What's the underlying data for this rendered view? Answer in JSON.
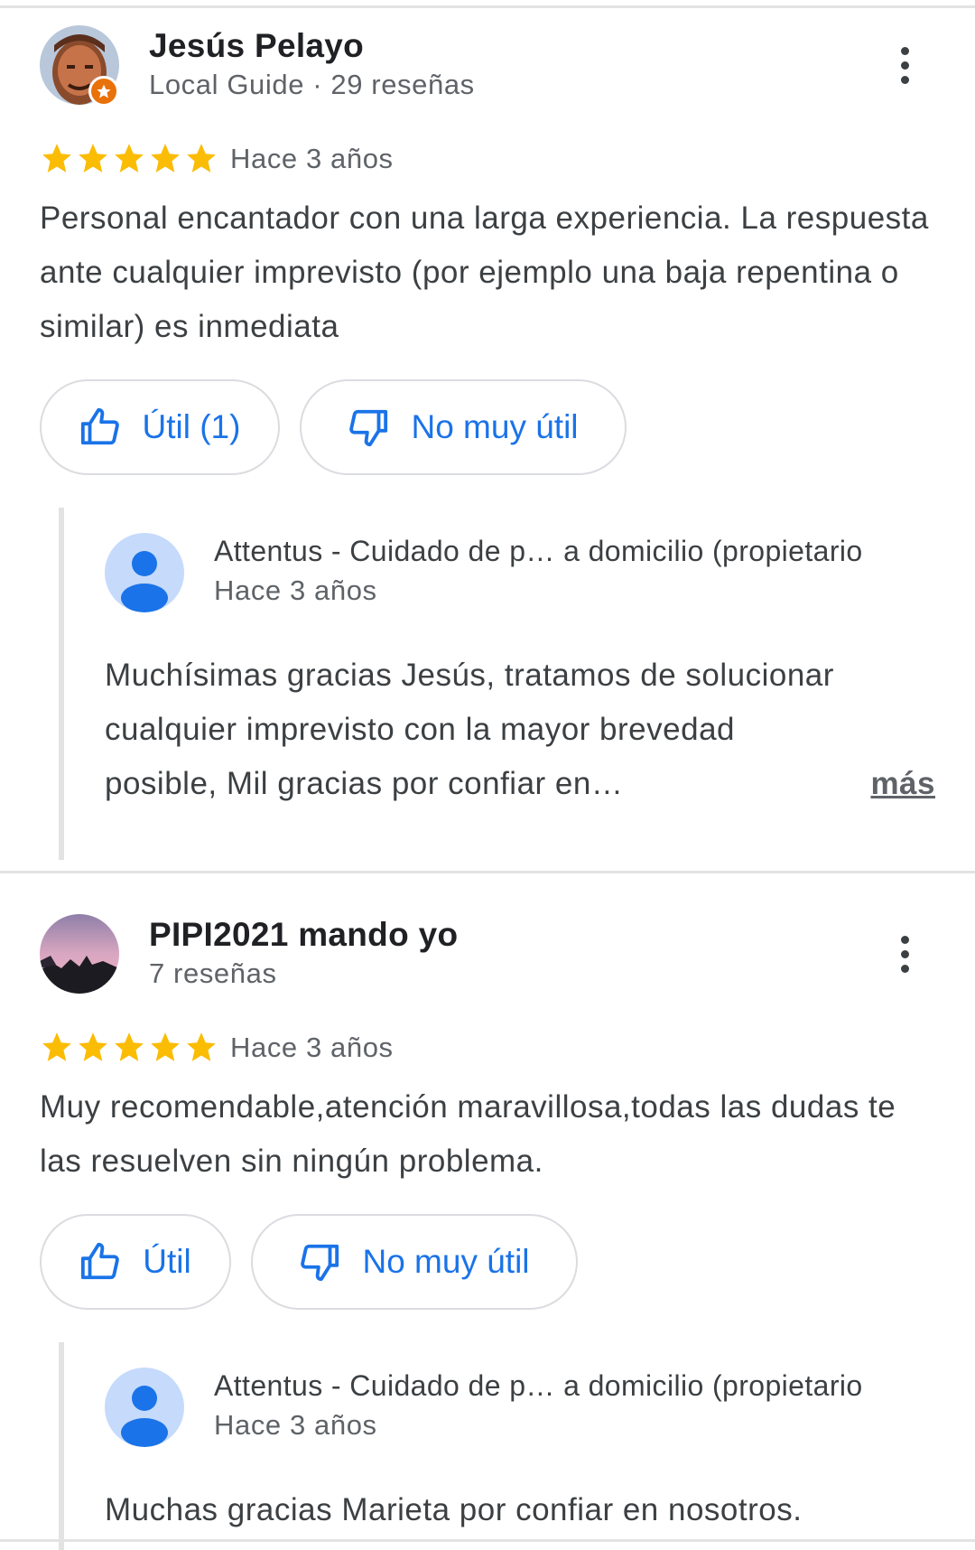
{
  "colors": {
    "star": "#fbbc04",
    "accent": "#1a73e8",
    "guide_badge": "#e8710a",
    "owner_avatar_bg": "#c6dafc",
    "owner_avatar_fg": "#1a73e8"
  },
  "icons": {
    "helpful": "thumb-up-icon",
    "not_helpful": "thumb-down-icon",
    "menu": "more-vert-icon",
    "rating": "star-icon",
    "guide": "local-guide-star-icon",
    "owner": "person-icon"
  },
  "reviews": [
    {
      "author": "Jesús Pelayo",
      "meta": "Local Guide · 29 reseñas",
      "rating": 5,
      "date": "Hace 3 años",
      "text": "Personal encantador con una larga experiencia. La respuesta ante cualquier imprevisto (por ejemplo una baja repentina o similar) es inmediata",
      "helpful_label": "Útil (1)",
      "not_helpful_label": "No muy útil",
      "reply": {
        "owner_name": "Attentus - Cuidado de p…  a domicilio (propietario",
        "date": "Hace 3 años",
        "text": "Muchísimas gracias Jesús, tratamos de solucionar cualquier imprevisto con la mayor brevedad posible, Mil gracias por confiar en…",
        "more_label": "más"
      }
    },
    {
      "author": "PIPI2021 mando yo",
      "meta": "7 reseñas",
      "rating": 5,
      "date": "Hace 3 años",
      "text": "Muy recomendable,atención maravillosa,todas las dudas te las resuelven sin ningún problema.",
      "helpful_label": "Útil",
      "not_helpful_label": "No muy útil",
      "reply": {
        "owner_name": "Attentus - Cuidado de p…  a domicilio (propietario",
        "date": "Hace 3 años",
        "text": "Muchas gracias Marieta por confiar en nosotros."
      }
    }
  ]
}
